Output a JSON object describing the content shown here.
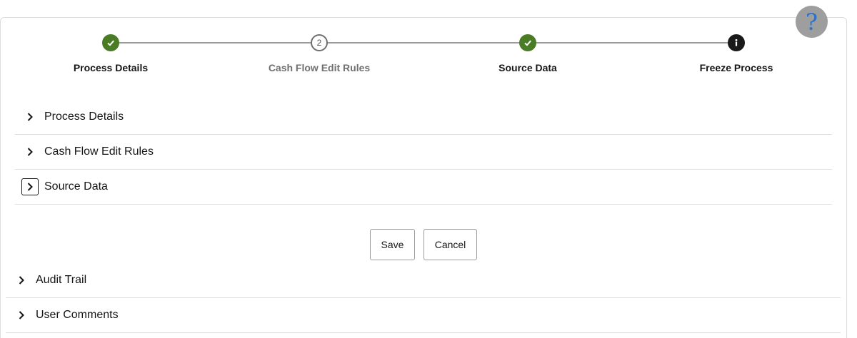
{
  "help": {
    "label": "?"
  },
  "train": {
    "steps": [
      {
        "label": "Process Details",
        "state": "done"
      },
      {
        "number": "2",
        "label": "Cash Flow Edit Rules",
        "state": "pending"
      },
      {
        "label": "Source Data",
        "state": "done"
      },
      {
        "label": "Freeze Process",
        "state": "info"
      }
    ]
  },
  "sections": [
    {
      "title": "Process Details"
    },
    {
      "title": "Cash Flow Edit Rules"
    },
    {
      "title": "Source Data"
    }
  ],
  "actions": {
    "save": "Save",
    "cancel": "Cancel"
  },
  "footer_sections": [
    {
      "title": "Audit Trail"
    },
    {
      "title": "User Comments"
    }
  ],
  "colors": {
    "done": "#4a7b25",
    "info": "#1a1a1a",
    "help_bg": "#9e9e9e",
    "help_glyph": "#2a73c9"
  }
}
